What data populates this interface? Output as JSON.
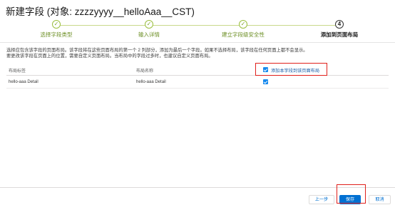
{
  "header": {
    "title": "新建字段 (对象: zzzzyyyy__helloAaa__CST)"
  },
  "wizard": {
    "steps": [
      {
        "label": "选择字段类型",
        "state": "complete"
      },
      {
        "label": "输入详情",
        "state": "complete"
      },
      {
        "label": "建立字段级安全性",
        "state": "complete"
      },
      {
        "number": "4",
        "label": "添加到页面布局",
        "state": "current"
      }
    ]
  },
  "instructions": {
    "line1": "选择应包含该字段的页面布局。该字段将在这些页面布局的第一个 2 列部分，添加为最后一个字段。如果不选择布局，该字段在任何页面上都不会显示。",
    "line2": "要更改该字段在页面上的位置，需要自定义页面布局。当布局中的字段过多时，也建议自定义页面布局。"
  },
  "layout_table": {
    "columns": [
      "布局标签",
      "布局名称"
    ],
    "add_all_label": "添加本字段到该页面布局",
    "add_all_checked": true,
    "rows": [
      {
        "label": "hello-aaa Detail",
        "name": "hello-aaa Detail",
        "checked": true
      }
    ]
  },
  "footer": {
    "previous_label": "上一步",
    "save_label": "保存",
    "cancel_label": "取消"
  },
  "colors": {
    "brand": "#0070d2",
    "step_complete": "#7fa62b",
    "highlight": "#e0201c"
  },
  "icons": {
    "step_complete": "check-icon",
    "checkbox": "checkbox-checked-icon"
  }
}
